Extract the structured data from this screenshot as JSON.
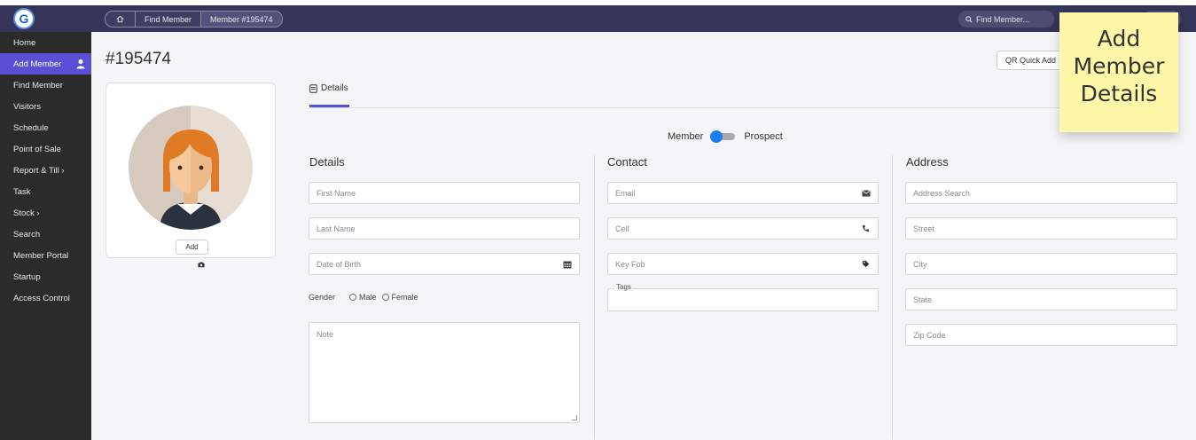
{
  "topbar": {
    "logo_letter": "G",
    "breadcrumbs": [
      "Find Member",
      "Member #195474"
    ],
    "search_placeholder": "Find Member..."
  },
  "sidebar": {
    "items": [
      {
        "label": "Home"
      },
      {
        "label": "Add Member"
      },
      {
        "label": "Find Member"
      },
      {
        "label": "Visitors"
      },
      {
        "label": "Schedule"
      },
      {
        "label": "Point of Sale"
      },
      {
        "label": "Report & Till ›"
      },
      {
        "label": "Task"
      },
      {
        "label": "Stock ›"
      },
      {
        "label": "Search"
      },
      {
        "label": "Member Portal"
      },
      {
        "label": "Startup"
      },
      {
        "label": "Access Control"
      }
    ],
    "active_index": 1
  },
  "page": {
    "title": "#195474",
    "qr_button": "QR Quick Add",
    "add_photo": "Add",
    "tab": "Details"
  },
  "toggle": {
    "left_label": "Member",
    "right_label": "Prospect"
  },
  "details": {
    "heading": "Details",
    "first_name": "First Name",
    "last_name": "Last Name",
    "dob": "Date of Birth",
    "gender_label": "Gender",
    "gender_options": [
      "Male",
      "Female"
    ],
    "note": "Note"
  },
  "contact": {
    "heading": "Contact",
    "email": "Email",
    "cell": "Cell",
    "key_fob": "Key Fob",
    "tags": "Tags"
  },
  "address": {
    "heading": "Address",
    "search": "Address Search",
    "street": "Street",
    "city": "City",
    "state": "State",
    "zip": "Zip Code"
  },
  "sticky_note": {
    "lines": [
      "Add",
      "Member",
      "Details"
    ]
  },
  "colors": {
    "topbar": "#35355a",
    "sidebar": "#2b2b2b",
    "accent": "#5b4fd6",
    "toggle": "#1f7cf0",
    "sticky": "#fff7a8"
  }
}
